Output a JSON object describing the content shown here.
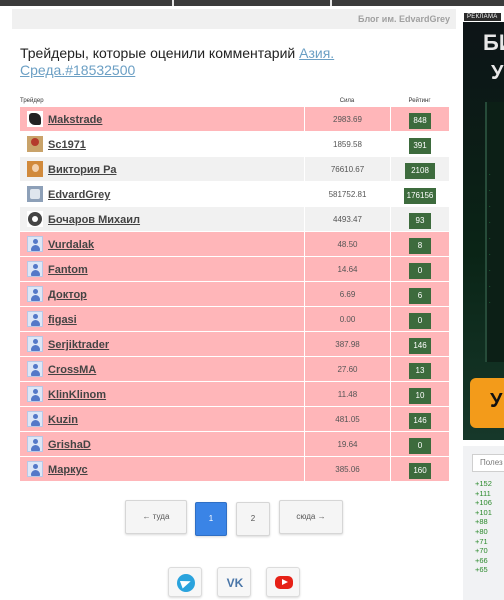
{
  "blog_title": "Блог им. EdvardGrey",
  "heading": {
    "text": "Трейдеры, которые оценили комментарий ",
    "link": "Азия. Среда.#18532500"
  },
  "table": {
    "columns": [
      "Трейдер",
      "Сила",
      "Рейтинг"
    ],
    "rows": [
      {
        "name": "Makstrade",
        "power": "2983.69",
        "rating": "848",
        "avatar": "fist-avatar",
        "highlight": "pink"
      },
      {
        "name": "Sc1971",
        "power": "1859.58",
        "rating": "391",
        "avatar": "photo-avatar",
        "highlight": "none"
      },
      {
        "name": "Виктория Ра",
        "power": "76610.67",
        "rating": "2108",
        "avatar": "photo-avatar",
        "highlight": "grey"
      },
      {
        "name": "EdvardGrey",
        "power": "581752.81",
        "rating": "176156",
        "avatar": "photo-avatar",
        "highlight": "none"
      },
      {
        "name": "Бочаров Михаил",
        "power": "4493.47",
        "rating": "93",
        "avatar": "photo-avatar",
        "highlight": "grey"
      },
      {
        "name": "Vurdalak",
        "power": "48.50",
        "rating": "8",
        "avatar": "default-user-avatar",
        "highlight": "pink"
      },
      {
        "name": "Fantom",
        "power": "14.64",
        "rating": "0",
        "avatar": "default-user-avatar",
        "highlight": "pink"
      },
      {
        "name": "Доктор",
        "power": "6.69",
        "rating": "6",
        "avatar": "default-user-avatar",
        "highlight": "pink"
      },
      {
        "name": "figasi",
        "power": "0.00",
        "rating": "0",
        "avatar": "default-user-avatar",
        "highlight": "pink"
      },
      {
        "name": "Serjiktrader",
        "power": "387.98",
        "rating": "146",
        "avatar": "default-user-avatar",
        "highlight": "pink"
      },
      {
        "name": "CrossMA",
        "power": "27.60",
        "rating": "13",
        "avatar": "default-user-avatar",
        "highlight": "pink"
      },
      {
        "name": "KlinKlinom",
        "power": "11.48",
        "rating": "10",
        "avatar": "default-user-avatar",
        "highlight": "pink"
      },
      {
        "name": "Kuzin",
        "power": "481.05",
        "rating": "146",
        "avatar": "default-user-avatar",
        "highlight": "pink"
      },
      {
        "name": "GrishaD",
        "power": "19.64",
        "rating": "0",
        "avatar": "default-user-avatar",
        "highlight": "pink"
      },
      {
        "name": "Маркус",
        "power": "385.06",
        "rating": "160",
        "avatar": "default-user-avatar",
        "highlight": "pink"
      }
    ]
  },
  "pagination": {
    "prev": "← туда",
    "pages": [
      "1",
      "2"
    ],
    "current": "1",
    "next": "сюда →"
  },
  "social": [
    {
      "icon": "telegram-icon"
    },
    {
      "icon": "vk-icon",
      "glyph": "VK"
    },
    {
      "icon": "youtube-icon"
    }
  ],
  "ad": {
    "label": "РЕКЛАМА",
    "text_top": "БИ",
    "text_second": "У",
    "cta": "У"
  },
  "right_panel": {
    "field_placeholder": "Полез",
    "values": [
      "+152",
      "+111",
      "+106",
      "+101",
      "+88",
      "+80",
      "+71",
      "+70",
      "+66",
      "+65"
    ]
  },
  "colors": {
    "highlight_pink": "#ffb6b9",
    "rating_badge": "#3d6b3d",
    "active_page": "#3a84e6",
    "link": "#6b9fc4"
  }
}
